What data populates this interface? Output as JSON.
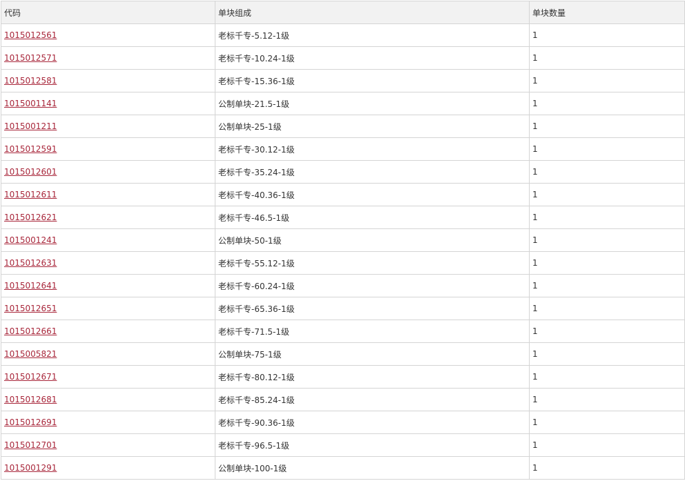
{
  "table": {
    "headers": {
      "code": "代码",
      "composition": "单块组成",
      "count": "单块数量"
    },
    "rows": [
      {
        "code": "1015012561",
        "composition": "老标千专-5.12-1级",
        "count": "1"
      },
      {
        "code": "1015012571",
        "composition": "老标千专-10.24-1级",
        "count": "1"
      },
      {
        "code": "1015012581",
        "composition": "老标千专-15.36-1级",
        "count": "1"
      },
      {
        "code": "1015001141",
        "composition": "公制单块-21.5-1级",
        "count": "1"
      },
      {
        "code": "1015001211",
        "composition": "公制单块-25-1级",
        "count": "1"
      },
      {
        "code": "1015012591",
        "composition": "老标千专-30.12-1级",
        "count": "1"
      },
      {
        "code": "1015012601",
        "composition": "老标千专-35.24-1级",
        "count": "1"
      },
      {
        "code": "1015012611",
        "composition": "老标千专-40.36-1级",
        "count": "1"
      },
      {
        "code": "1015012621",
        "composition": "老标千专-46.5-1级",
        "count": "1"
      },
      {
        "code": "1015001241",
        "composition": "公制单块-50-1级",
        "count": "1"
      },
      {
        "code": "1015012631",
        "composition": "老标千专-55.12-1级",
        "count": "1"
      },
      {
        "code": "1015012641",
        "composition": "老标千专-60.24-1级",
        "count": "1"
      },
      {
        "code": "1015012651",
        "composition": "老标千专-65.36-1级",
        "count": "1"
      },
      {
        "code": "1015012661",
        "composition": "老标千专-71.5-1级",
        "count": "1"
      },
      {
        "code": "1015005821",
        "composition": "公制单块-75-1级",
        "count": "1"
      },
      {
        "code": "1015012671",
        "composition": "老标千专-80.12-1级",
        "count": "1"
      },
      {
        "code": "1015012681",
        "composition": "老标千专-85.24-1级",
        "count": "1"
      },
      {
        "code": "1015012691",
        "composition": "老标千专-90.36-1级",
        "count": "1"
      },
      {
        "code": "1015012701",
        "composition": "老标千专-96.5-1级",
        "count": "1"
      },
      {
        "code": "1015001291",
        "composition": "公制单块-100-1级",
        "count": "1"
      }
    ]
  },
  "colors": {
    "link": "#a8263a",
    "header_bg": "#f2f2f2",
    "border": "#d4d4d4",
    "text": "#333333"
  }
}
